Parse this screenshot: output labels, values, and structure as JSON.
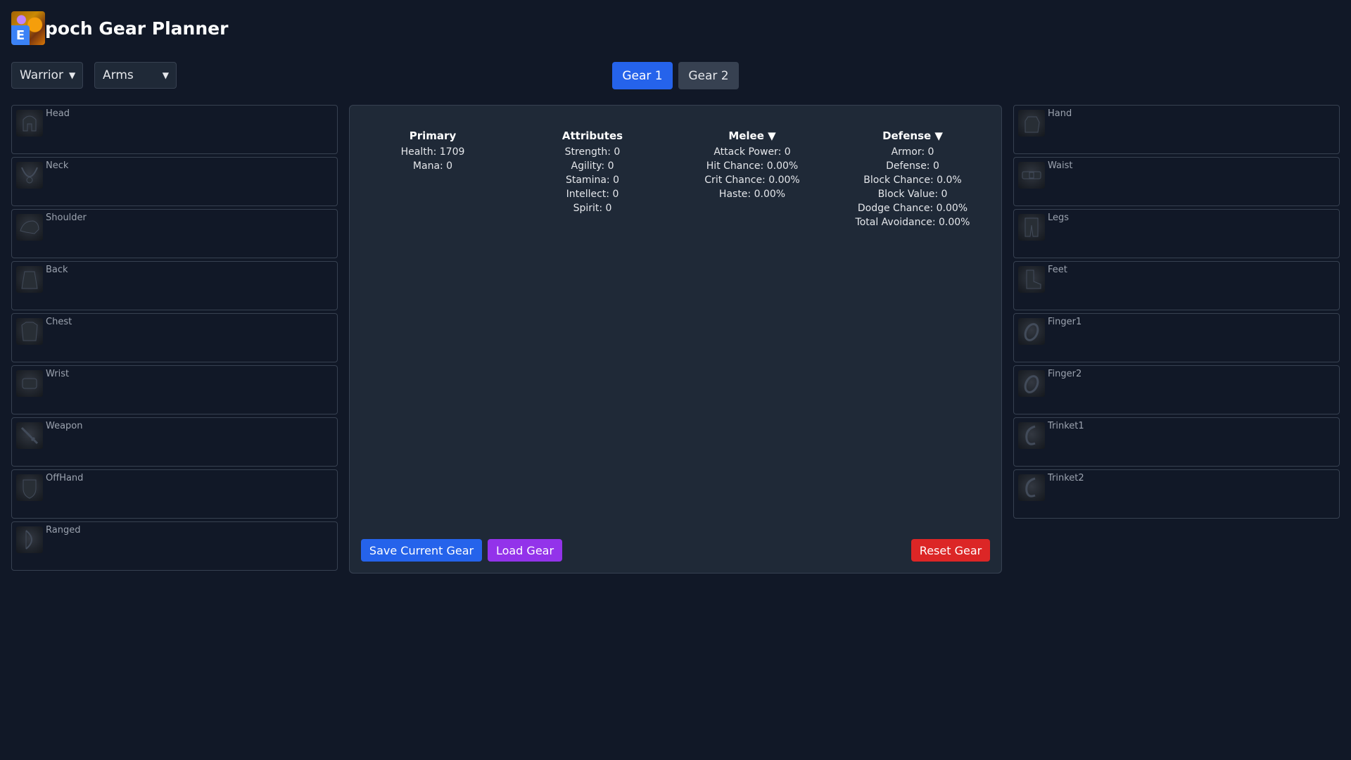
{
  "app": {
    "title": "poch Gear Planner",
    "logo_letter": "E"
  },
  "selects": {
    "class": "Warrior",
    "spec": "Arms"
  },
  "tabs": [
    "Gear 1",
    "Gear 2"
  ],
  "slots_left": [
    "Head",
    "Neck",
    "Shoulder",
    "Back",
    "Chest",
    "Wrist",
    "Weapon",
    "OffHand",
    "Ranged"
  ],
  "slots_right": [
    "Hand",
    "Waist",
    "Legs",
    "Feet",
    "Finger1",
    "Finger2",
    "Trinket1",
    "Trinket2"
  ],
  "stats": {
    "primary": {
      "title": "Primary",
      "rows": [
        "Health: 1709",
        "Mana: 0"
      ]
    },
    "attributes": {
      "title": "Attributes",
      "rows": [
        "Strength: 0",
        "Agility: 0",
        "Stamina: 0",
        "Intellect: 0",
        "Spirit: 0"
      ]
    },
    "melee": {
      "title": "Melee ▼",
      "rows": [
        "Attack Power: 0",
        "Hit Chance: 0.00%",
        "Crit Chance: 0.00%",
        "Haste: 0.00%"
      ]
    },
    "defense": {
      "title": "Defense ▼",
      "rows": [
        "Armor: 0",
        "Defense: 0",
        "Block Chance: 0.0%",
        "Block Value: 0",
        "Dodge Chance: 0.00%",
        "Total Avoidance: 0.00%"
      ]
    }
  },
  "buttons": {
    "save": "Save Current Gear",
    "load": "Load Gear",
    "reset": "Reset Gear"
  },
  "colors": {
    "background": "#111827",
    "panel": "#1f2937",
    "primary": "#2563eb",
    "load": "#9333ea",
    "reset": "#dc2626"
  }
}
